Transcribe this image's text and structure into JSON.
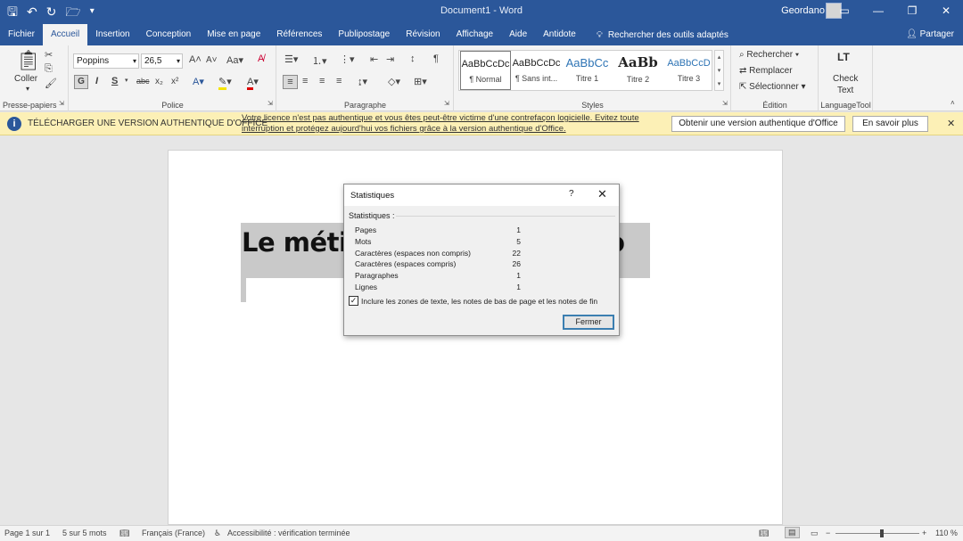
{
  "titlebar": {
    "doc_title": "Document1 - Word",
    "user": "Geordano"
  },
  "menu": {
    "tabs": [
      "Fichier",
      "Accueil",
      "Insertion",
      "Conception",
      "Mise en page",
      "Références",
      "Publipostage",
      "Révision",
      "Affichage",
      "Aide",
      "Antidote"
    ],
    "active": "Accueil",
    "search": "Rechercher des outils adaptés",
    "share": "Partager"
  },
  "ribbon": {
    "clipboard": {
      "paste": "Coller",
      "label": "Presse-papiers"
    },
    "font": {
      "name": "Poppins",
      "size": "26,5",
      "label": "Police"
    },
    "paragraph": {
      "label": "Paragraphe"
    },
    "styles": {
      "label": "Styles",
      "items": [
        {
          "sample": "AaBbCcDc",
          "name": "¶ Normal"
        },
        {
          "sample": "AaBbCcDc",
          "name": "¶ Sans int..."
        },
        {
          "sample": "AaBbCc",
          "name": "Titre 1"
        },
        {
          "sample": "AaBb",
          "name": "Titre 2"
        },
        {
          "sample": "AaBbCcD",
          "name": "Titre 3"
        }
      ]
    },
    "edition": {
      "find": "Rechercher",
      "replace": "Remplacer",
      "select": "Sélectionner",
      "label": "Édition"
    },
    "languagetool": {
      "line1": "Check",
      "line2": "Text",
      "label": "LanguageTool",
      "logo": "LT"
    }
  },
  "notice": {
    "head": "TÉLÉCHARGER UNE VERSION AUTHENTIQUE D'OFFICE",
    "message": "Votre licence n'est pas authentique et vous êtes peut-être victime d'une contrefaçon logicielle. Evitez toute interruption et protégez aujourd'hui vos fichiers grâce à la version authentique d'Office.",
    "btn_get": "Obtenir une version authentique d'Office",
    "btn_more": "En savoir plus"
  },
  "document": {
    "heading_visible": "Le métie",
    "heading_tail": "o"
  },
  "dialog": {
    "title": "Statistiques",
    "help": "?",
    "section": "Statistiques :",
    "rows": [
      {
        "label": "Pages",
        "value": "1"
      },
      {
        "label": "Mots",
        "value": "5"
      },
      {
        "label": "Caractères (espaces non compris)",
        "value": "22"
      },
      {
        "label": "Caractères (espaces compris)",
        "value": "26"
      },
      {
        "label": "Paragraphes",
        "value": "1"
      },
      {
        "label": "Lignes",
        "value": "1"
      }
    ],
    "checkbox_label": "Inclure les zones de texte, les notes de bas de page et les notes de fin",
    "checkbox_checked": true,
    "close_button": "Fermer"
  },
  "status": {
    "page": "Page 1 sur 1",
    "words": "5 sur 5 mots",
    "language": "Français (France)",
    "accessibility": "Accessibilité : vérification terminée",
    "zoom": "110 %"
  }
}
